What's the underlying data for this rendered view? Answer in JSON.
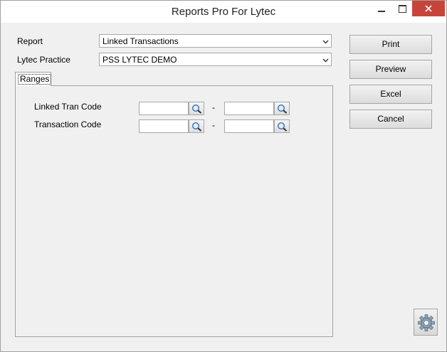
{
  "window": {
    "title": "Reports Pro For Lytec",
    "controls": {
      "minimize": "minimize-icon",
      "maximize": "maximize-icon",
      "close": "close-icon"
    }
  },
  "form": {
    "report_label": "Report",
    "report_value": "Linked Transactions",
    "practice_label": "Lytec Practice",
    "practice_value": "PSS LYTEC DEMO"
  },
  "tabs": [
    {
      "label": "Ranges"
    }
  ],
  "ranges": {
    "rows": [
      {
        "label": "Linked Tran Code",
        "from": "",
        "to": "",
        "separator": "-"
      },
      {
        "label": "Transaction Code",
        "from": "",
        "to": "",
        "separator": "-"
      }
    ]
  },
  "actions": {
    "print": "Print",
    "preview": "Preview",
    "excel": "Excel",
    "cancel": "Cancel",
    "settings_icon": "gear-icon"
  },
  "colors": {
    "close_button": "#c7443a",
    "window_bg": "#f0f0f0"
  }
}
